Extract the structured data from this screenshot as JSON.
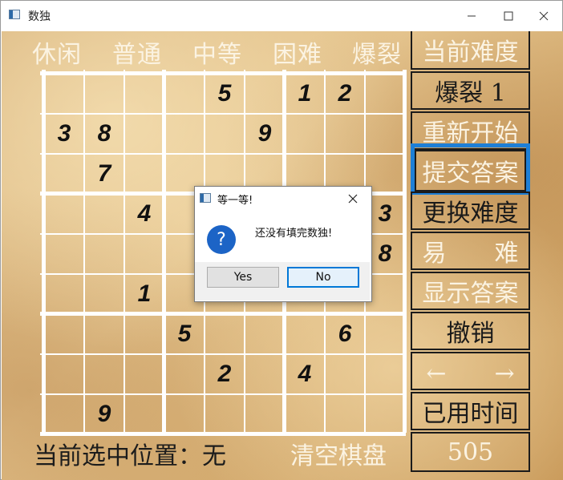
{
  "window": {
    "title": "数独"
  },
  "difficulty_tabs": [
    "休闲",
    "普通",
    "中等",
    "困难",
    "爆裂"
  ],
  "side_buttons": [
    {
      "label": "当前难度",
      "name": "current-difficulty-header"
    },
    {
      "label": "爆裂 1",
      "name": "difficulty-level-display"
    },
    {
      "label": "重新开始",
      "name": "restart-button"
    },
    {
      "label": "提交答案",
      "name": "submit-answer-button"
    },
    {
      "label": "更换难度",
      "name": "change-difficulty-button"
    },
    {
      "label": "易　　难",
      "name": "easy-hard-toggle"
    },
    {
      "label": "显示答案",
      "name": "show-answer-button"
    },
    {
      "label": "撤销",
      "name": "undo-button"
    },
    {
      "label": "←　　→",
      "name": "arrow-navigation"
    },
    {
      "label": "已用时间",
      "name": "elapsed-time-label"
    },
    {
      "label": "505",
      "name": "elapsed-time-value"
    }
  ],
  "board": {
    "cells": [
      [
        "",
        "",
        "",
        "",
        "5",
        "",
        "1",
        "2",
        ""
      ],
      [
        "3",
        "8",
        "",
        "",
        "",
        "9",
        "",
        "",
        ""
      ],
      [
        "",
        "7",
        "",
        "",
        "",
        "",
        "",
        "",
        ""
      ],
      [
        "",
        "",
        "4",
        "",
        "",
        "",
        "",
        "",
        "3"
      ],
      [
        "",
        "",
        "",
        "",
        "",
        "",
        "",
        "",
        "8"
      ],
      [
        "",
        "",
        "1",
        "",
        "",
        "",
        "",
        "",
        ""
      ],
      [
        "",
        "",
        "",
        "5",
        "",
        "",
        "",
        "6",
        ""
      ],
      [
        "",
        "",
        "",
        "",
        "2",
        "",
        "4",
        "",
        ""
      ],
      [
        "",
        "9",
        "",
        "",
        "",
        "",
        "",
        "",
        ""
      ]
    ]
  },
  "bottom": {
    "selection_label": "当前选中位置：无",
    "clear_button": "清空棋盘"
  },
  "dialog": {
    "title": "等一等!",
    "message": "还没有填完数独!",
    "yes_label": "Yes",
    "no_label": "No"
  },
  "colors": {
    "accent_selected": "#1e7fd6",
    "dialog_question_icon": "#1c64c6"
  }
}
